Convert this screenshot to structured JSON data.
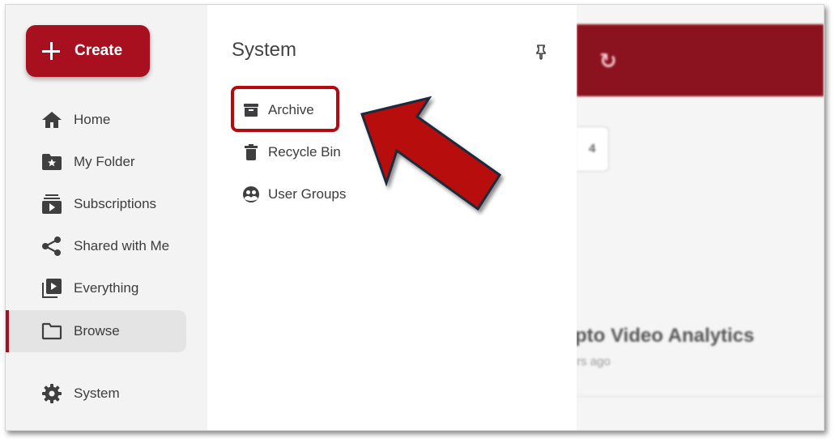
{
  "sidebar": {
    "create_label": "Create",
    "items": [
      {
        "label": "Home",
        "icon": "home-icon"
      },
      {
        "label": "My Folder",
        "icon": "folder-star-icon"
      },
      {
        "label": "Subscriptions",
        "icon": "subscriptions-icon"
      },
      {
        "label": "Shared with Me",
        "icon": "share-icon"
      },
      {
        "label": "Everything",
        "icon": "video-library-icon"
      },
      {
        "label": "Browse",
        "icon": "folder-outline-icon",
        "active": true
      },
      {
        "label": "System",
        "icon": "gear-icon"
      }
    ]
  },
  "panel": {
    "title": "System",
    "items": [
      {
        "label": "Archive",
        "icon": "archive-icon"
      },
      {
        "label": "Recycle Bin",
        "icon": "trash-icon"
      },
      {
        "label": "User Groups",
        "icon": "user-groups-icon"
      }
    ]
  },
  "background": {
    "page_number": "4",
    "video_title": "pto Video Analytics",
    "video_subtitle": "rs ago"
  },
  "colors": {
    "brand": "#a80f1f",
    "header": "#8b121f",
    "annotation": "#b40a12"
  }
}
